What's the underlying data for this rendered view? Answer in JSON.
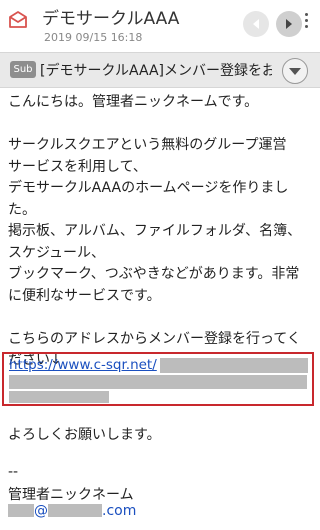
{
  "header": {
    "app_icon": "mail-icon",
    "title": "デモサークルAAA",
    "date": "2019 09/15 16:18",
    "prev_icon": "chevron-left-icon",
    "next_icon": "chevron-right-icon",
    "menu_icon": "more-vertical-icon"
  },
  "subject": {
    "badge": "Sub",
    "text": "[デモサークルAAA]メンバー登録をお",
    "expand_icon": "chevron-down-icon"
  },
  "body": {
    "lines": [
      "こんにちは。管理者ニックネームです。",
      "",
      "サークルスクエアという無料のグループ運営",
      "サービスを利用して、",
      "デモサークルAAAのホームページを作りまし",
      "た。",
      "掲示板、アルバム、ファイルフォルダ、名簿、",
      "スケジュール、",
      "ブックマーク、つぶやきなどがあります。非常",
      "に便利なサービスです。",
      "",
      "こちらのアドレスからメンバー登録を行ってく",
      "ださい↓"
    ],
    "link_text": "https://www.c-sqr.net/",
    "closing": "よろしくお願いします。",
    "signature_separator": "--",
    "signature_name": "管理者ニックネーム",
    "signature_email_domain": "@",
    "signature_email_tld": ".com"
  },
  "colors": {
    "highlight_border": "#c8282d",
    "link": "#1a4fbf",
    "subject_bar": "#e9e9e9",
    "mail_icon": "#d9534f"
  }
}
